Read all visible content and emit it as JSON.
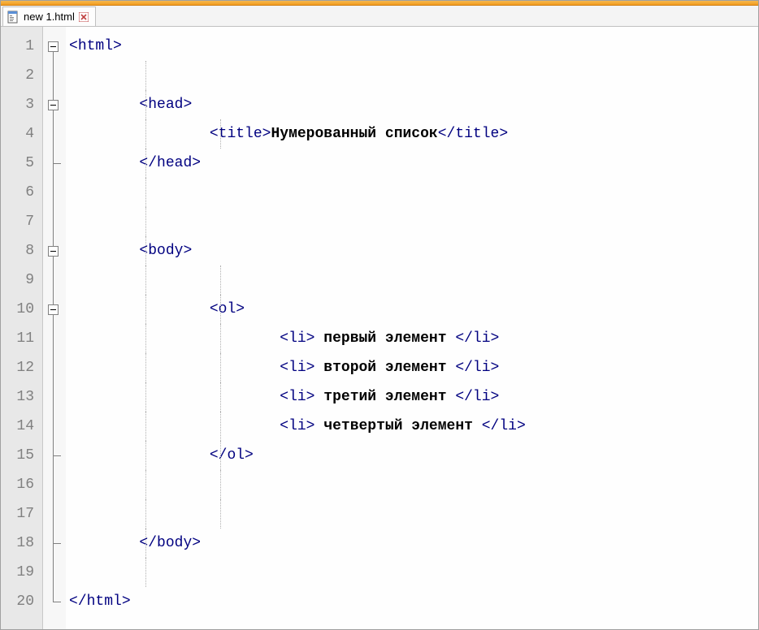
{
  "tab": {
    "filename": "new  1.html"
  },
  "code": {
    "line_count": 20,
    "tags": {
      "html_open": "html",
      "html_close": "/html",
      "head_open": "head",
      "head_close": "/head",
      "title_open": "title",
      "title_close": "/title",
      "body_open": "body",
      "body_close": "/body",
      "ol_open": "ol",
      "ol_close": "/ol",
      "li_open": "li",
      "li_close": "/li"
    },
    "title_text": "Нумерованный список",
    "items": {
      "i1": " первый элемент ",
      "i2": " второй элемент ",
      "i3": " третий элемент ",
      "i4": " четвертый элемент "
    }
  }
}
